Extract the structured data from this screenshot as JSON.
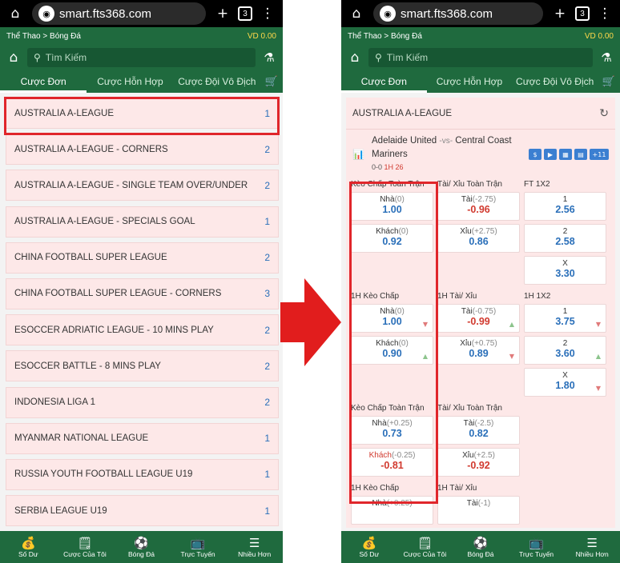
{
  "browser": {
    "url": "smart.fts368.com",
    "tab_count": "3"
  },
  "app": {
    "breadcrumb": "Thể Thao > Bóng Đá",
    "balance": "VD 0.00",
    "search_placeholder": "Tìm Kiếm",
    "tabs": [
      "Cược Đơn",
      "Cược Hỗn Hợp",
      "Cược Đội Vô Địch"
    ]
  },
  "left": {
    "leagues": [
      {
        "name": "AUSTRALIA A-LEAGUE",
        "count": "1"
      },
      {
        "name": "AUSTRALIA A-LEAGUE - CORNERS",
        "count": "2"
      },
      {
        "name": "AUSTRALIA A-LEAGUE - SINGLE TEAM OVER/UNDER",
        "count": "2"
      },
      {
        "name": "AUSTRALIA A-LEAGUE - SPECIALS GOAL",
        "count": "1"
      },
      {
        "name": "CHINA FOOTBALL SUPER LEAGUE",
        "count": "2"
      },
      {
        "name": "CHINA FOOTBALL SUPER LEAGUE - CORNERS",
        "count": "3"
      },
      {
        "name": "ESOCCER ADRIATIC LEAGUE - 10 MINS PLAY",
        "count": "2"
      },
      {
        "name": "ESOCCER BATTLE - 8 MINS PLAY",
        "count": "2"
      },
      {
        "name": "INDONESIA LIGA 1",
        "count": "2"
      },
      {
        "name": "MYANMAR NATIONAL LEAGUE",
        "count": "1"
      },
      {
        "name": "RUSSIA YOUTH FOOTBALL LEAGUE U19",
        "count": "1"
      },
      {
        "name": "SERBIA LEAGUE U19",
        "count": "1"
      }
    ]
  },
  "right": {
    "league_title": "AUSTRALIA A-LEAGUE",
    "match": {
      "home": "Adelaide United",
      "vs": "-vs-",
      "away": "Central Coast",
      "away2": "Mariners",
      "score": "0-0",
      "time": "1H 26",
      "more": "+11"
    },
    "sections": [
      {
        "labels": [
          "Kèo Chấp Toàn Trận",
          "Tài/ Xỉu Toàn Trận",
          "FT 1X2"
        ],
        "rows": [
          [
            {
              "lbl": "Nhà",
              "hc": "(0)",
              "val": "1.00"
            },
            {
              "lbl": "Tài",
              "hc": "(-2.75)",
              "val": "-0.96",
              "neg": true
            },
            {
              "lbl": "1",
              "hc": "",
              "val": "2.56"
            }
          ],
          [
            {
              "lbl": "Khách",
              "hc": "(0)",
              "val": "0.92"
            },
            {
              "lbl": "Xỉu",
              "hc": "(+2.75)",
              "val": "0.86"
            },
            {
              "lbl": "2",
              "hc": "",
              "val": "2.58"
            }
          ],
          [
            null,
            null,
            {
              "lbl": "X",
              "hc": "",
              "val": "3.30"
            }
          ]
        ]
      },
      {
        "labels": [
          "1H Kèo Chấp",
          "1H Tài/ Xỉu",
          "1H 1X2"
        ],
        "rows": [
          [
            {
              "lbl": "Nhà",
              "hc": "(0)",
              "val": "1.00",
              "tri": "down"
            },
            {
              "lbl": "Tài",
              "hc": "(-0.75)",
              "val": "-0.99",
              "neg": true,
              "tri": "up"
            },
            {
              "lbl": "1",
              "hc": "",
              "val": "3.75",
              "tri": "down"
            }
          ],
          [
            {
              "lbl": "Khách",
              "hc": "(0)",
              "val": "0.90",
              "tri": "up"
            },
            {
              "lbl": "Xỉu",
              "hc": "(+0.75)",
              "val": "0.89",
              "tri": "down"
            },
            {
              "lbl": "2",
              "hc": "",
              "val": "3.60",
              "tri": "up"
            }
          ],
          [
            null,
            null,
            {
              "lbl": "X",
              "hc": "",
              "val": "1.80",
              "tri": "down"
            }
          ]
        ]
      },
      {
        "labels": [
          "Kèo Chấp Toàn Trận",
          "Tài/ Xỉu Toàn Trận",
          ""
        ],
        "rows": [
          [
            {
              "lbl": "Nhà",
              "hc": "(+0.25)",
              "val": "0.73"
            },
            {
              "lbl": "Tài",
              "hc": "(-2.5)",
              "val": "0.82"
            },
            null
          ],
          [
            {
              "lbl": "Khách",
              "hc": "(-0.25)",
              "val": "-0.81",
              "neg": true,
              "red": true
            },
            {
              "lbl": "Xỉu",
              "hc": "(+2.5)",
              "val": "-0.92",
              "neg": true
            },
            null
          ]
        ]
      },
      {
        "labels": [
          "1H Kèo Chấp",
          "1H Tài/ Xỉu",
          ""
        ],
        "rows": [
          [
            {
              "lbl": "Nhà",
              "hc": "(+0.25)",
              "val": ""
            },
            {
              "lbl": "Tài",
              "hc": "(-1)",
              "val": ""
            },
            null
          ]
        ]
      }
    ]
  },
  "bottom_nav": [
    {
      "label": "Số Dư",
      "icon": "wallet-icon",
      "glyph": "💰"
    },
    {
      "label": "Cược Của Tôi",
      "icon": "bets-icon",
      "glyph": "🗒"
    },
    {
      "label": "Bóng Đá",
      "icon": "soccer-ball-icon",
      "glyph": "⚽"
    },
    {
      "label": "Trực Tuyến",
      "icon": "live-tv-icon",
      "glyph": "📺"
    },
    {
      "label": "Nhiều Hơn",
      "icon": "menu-icon",
      "glyph": "☰"
    }
  ],
  "colors": {
    "brand_green": "#1f6a3e",
    "highlight_red": "#e0262b",
    "odds_blue": "#2a6fb9",
    "odds_red": "#d13a2f"
  }
}
